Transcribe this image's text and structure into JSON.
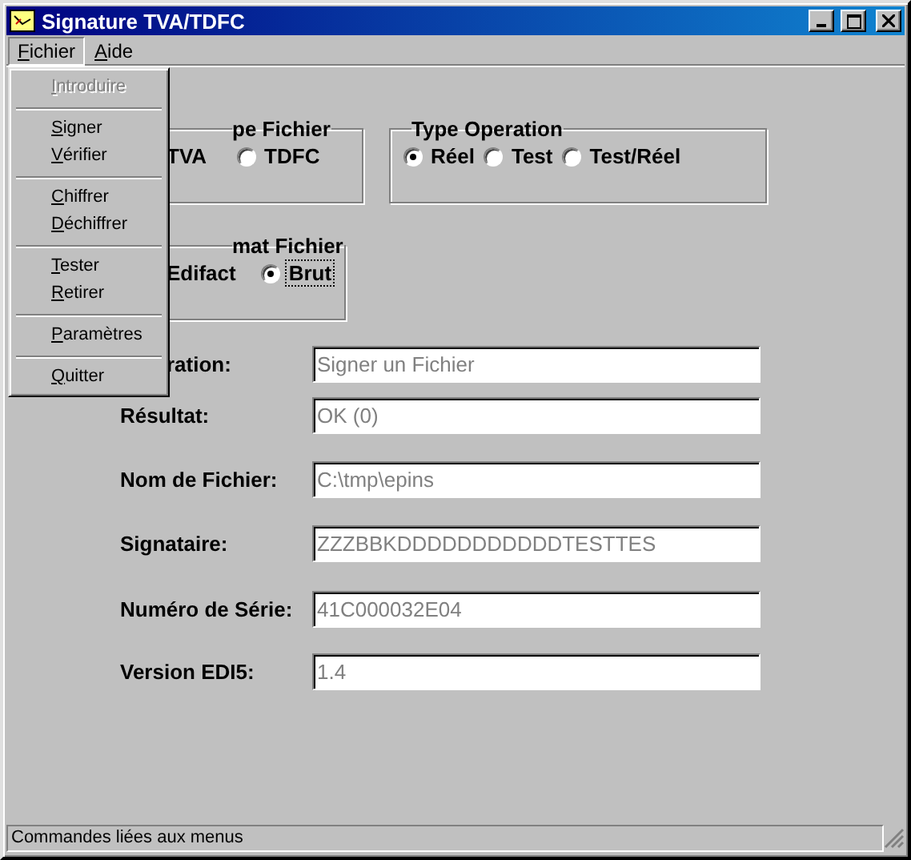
{
  "window": {
    "title": "Signature TVA/TDFC"
  },
  "menu_bar": [
    {
      "label": "Fichier",
      "open": true
    },
    {
      "label": "Aide",
      "open": false
    }
  ],
  "open_menu": {
    "items": [
      {
        "kind": "item",
        "label": "Introduire",
        "disabled": true
      },
      {
        "kind": "separator"
      },
      {
        "kind": "item",
        "label": "Signer",
        "disabled": false
      },
      {
        "kind": "item",
        "label": "Vérifier",
        "disabled": false
      },
      {
        "kind": "separator"
      },
      {
        "kind": "item",
        "label": "Chiffrer",
        "disabled": false
      },
      {
        "kind": "item",
        "label": "Déchiffrer",
        "disabled": false
      },
      {
        "kind": "separator"
      },
      {
        "kind": "item",
        "label": "Tester",
        "disabled": false
      },
      {
        "kind": "item",
        "label": "Retirer",
        "disabled": false
      },
      {
        "kind": "separator"
      },
      {
        "kind": "item",
        "label": "Paramètres",
        "disabled": false
      },
      {
        "kind": "separator"
      },
      {
        "kind": "item",
        "label": "Quitter",
        "disabled": false
      }
    ]
  },
  "type_fichier": {
    "legend": "pe Fichier",
    "options": [
      {
        "label": "TVA"
      },
      {
        "label": "TDFC",
        "selected": false
      }
    ]
  },
  "type_operation": {
    "legend": "Type Operation",
    "options": [
      {
        "label": "Réel",
        "selected": true
      },
      {
        "label": "Test",
        "selected": false
      },
      {
        "label": "Test/Réel",
        "selected": false
      }
    ]
  },
  "format_fichier": {
    "legend": "mat Fichier",
    "options": [
      {
        "label": "Edifact"
      },
      {
        "label": "Brut",
        "selected": true,
        "focused": true
      }
    ]
  },
  "fields": [
    {
      "label": "ration:",
      "value": "Signer un Fichier"
    },
    {
      "label": "Résultat:",
      "value": "OK (0)"
    },
    {
      "label": "Nom de Fichier:",
      "value": "C:\\tmp\\epins"
    },
    {
      "label": "Signataire:",
      "value": "ZZZBBKDDDDDDDDDDDTESTTES"
    },
    {
      "label": "Numéro de Série:",
      "value": "41C000032E04"
    },
    {
      "label": "Version EDI5:",
      "value": "1.4"
    }
  ],
  "status_bar": "Commandes liées aux menus"
}
